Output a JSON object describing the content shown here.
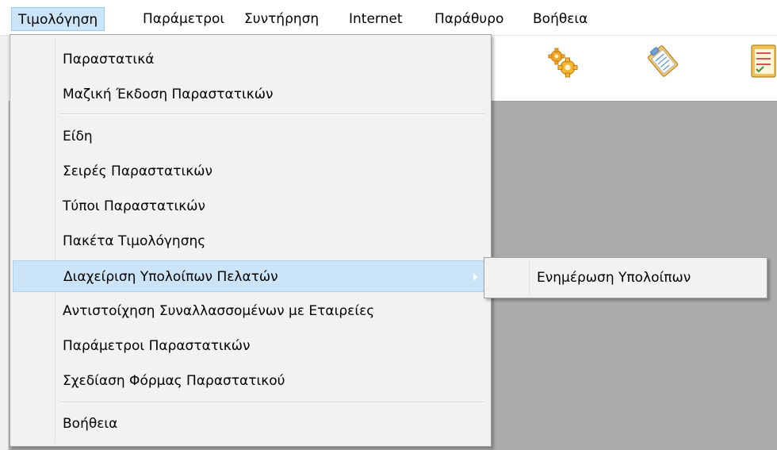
{
  "menubar": {
    "items": [
      {
        "label": "Τιμολόγηση",
        "active": true
      },
      {
        "label": "Παράμετροι"
      },
      {
        "label": "Συντήρηση"
      },
      {
        "label": "Internet"
      },
      {
        "label": "Παράθυρο"
      },
      {
        "label": "Βοήθεια"
      }
    ]
  },
  "toolbar": {
    "icons": [
      "gears-icon",
      "clipboard-icon",
      "checklist-icon"
    ]
  },
  "dropdown": {
    "items": [
      {
        "label": "Παραστατικά"
      },
      {
        "label": "Μαζική Έκδοση Παραστατικών"
      },
      {
        "label": "Είδη"
      },
      {
        "label": "Σειρές Παραστατικών"
      },
      {
        "label": "Τύποι Παραστατικών"
      },
      {
        "label": "Πακέτα Τιμολόγησης"
      },
      {
        "label": "Διαχείριση Υπολοίπων Πελατών",
        "highlighted": true,
        "has_submenu": true
      },
      {
        "label": "Αντιστοίχηση Συναλλασσομένων με Εταιρείες"
      },
      {
        "label": "Παράμετροι Παραστατικών"
      },
      {
        "label": "Σχεδίαση Φόρμας Παραστατικού"
      },
      {
        "label": "Βοήθεια"
      }
    ]
  },
  "submenu": {
    "items": [
      {
        "label": "Ενημέρωση Υπολοίπων"
      }
    ]
  },
  "colors": {
    "highlight": "#cce4f7",
    "menu_background": "#f2f2f2",
    "workspace": "#ababab"
  }
}
